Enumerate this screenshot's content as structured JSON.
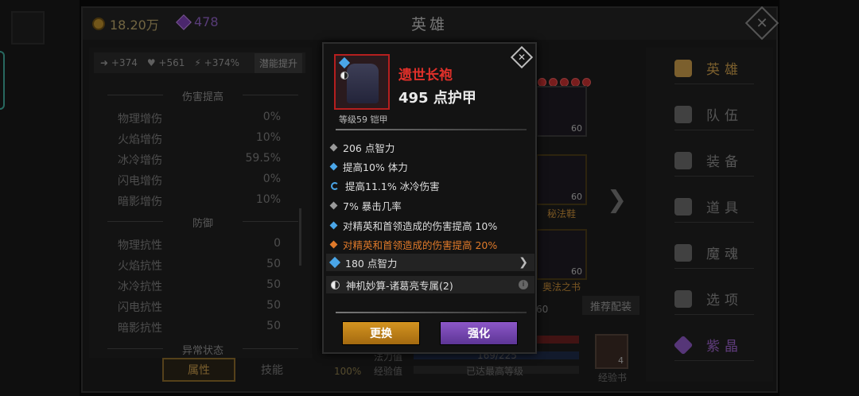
{
  "currency": {
    "gold": "18.20万",
    "gems": "478"
  },
  "page_title": "英雄",
  "close_glyph": "✕",
  "stat_bar": {
    "dmg": "+374",
    "hp": "+561",
    "power": "+374%",
    "button": "潜能提升"
  },
  "attr": {
    "damage_title": "伤害提高",
    "damage": [
      {
        "label": "物理增伤",
        "value": "0%"
      },
      {
        "label": "火焰增伤",
        "value": "10%"
      },
      {
        "label": "冰冷增伤",
        "value": "59.5%"
      },
      {
        "label": "闪电增伤",
        "value": "0%"
      },
      {
        "label": "暗影增伤",
        "value": "10%"
      }
    ],
    "defense_title": "防御",
    "defense": [
      {
        "label": "物理抗性",
        "value": "0"
      },
      {
        "label": "火焰抗性",
        "value": "50"
      },
      {
        "label": "冰冷抗性",
        "value": "50"
      },
      {
        "label": "闪电抗性",
        "value": "50"
      },
      {
        "label": "暗影抗性",
        "value": "50"
      }
    ],
    "abnormal_title": "异常状态"
  },
  "tabs": {
    "attributes": "属性",
    "skills": "技能"
  },
  "slots": {
    "top_level": "60",
    "boots_level": "60",
    "boots_name": "秘法鞋",
    "book_level": "60",
    "book_name": "奥法之书",
    "partial_level": "60"
  },
  "recommend": "推荐配装",
  "bars": {
    "mana": "法力值",
    "mana_value": "169/225",
    "exp": "经验值",
    "exp_value": "已达最高等级",
    "percent": "100%"
  },
  "exp_book": {
    "count": "4",
    "label": "经验书"
  },
  "menu": [
    "英雄",
    "队伍",
    "装备",
    "道具",
    "魔魂",
    "选项",
    "紫晶"
  ],
  "item": {
    "name": "遗世长袍",
    "armor": "495 点护甲",
    "type": "等级59 铠甲",
    "affixes": [
      {
        "text": "206 点智力",
        "style": "gray"
      },
      {
        "text": "提高10% 体力",
        "style": "blue"
      },
      {
        "text": "提高11.1% 冰冷伤害",
        "style": "cycle"
      },
      {
        "text": "7% 暴击几率",
        "style": "gray"
      },
      {
        "text": "对精英和首领造成的伤害提高 10%",
        "style": "blue"
      },
      {
        "text": "对精英和首领造成的伤害提高 20%",
        "style": "orange"
      }
    ],
    "socket": "180 点智力",
    "set": "神机妙算-诸葛亮专属(2)"
  },
  "buttons": {
    "replace": "更换",
    "enhance": "强化"
  },
  "colors": {
    "legendary": "#e0302a",
    "accent_gold": "#c79a4a",
    "accent_purple": "#8c57c2"
  }
}
